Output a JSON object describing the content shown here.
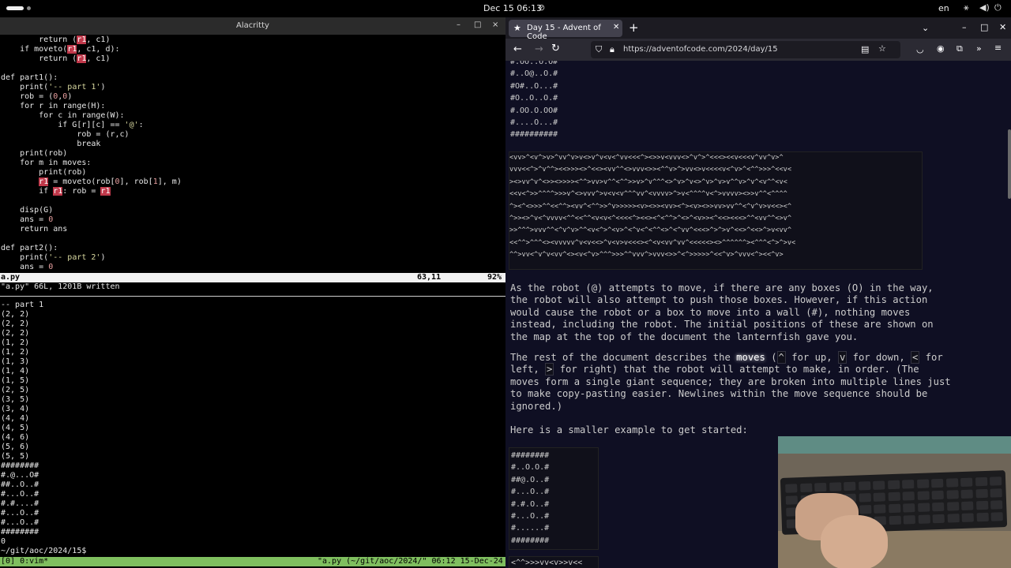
{
  "topbar": {
    "clock": "Dec 15  06:13",
    "language": "en"
  },
  "terminal": {
    "title": "Alacritty",
    "window_buttons": {
      "minimize": "–",
      "maximize": "□",
      "close": "×"
    },
    "statusline": {
      "file": "a.py",
      "position": "63,11",
      "percent": "92%"
    },
    "message": "\"a.py\" 66L, 1201B written",
    "output_lines": [
      "-- part 1",
      "(2, 2)",
      "(2, 2)",
      "(2, 2)",
      "(1, 2)",
      "(1, 2)",
      "(1, 3)",
      "(1, 4)",
      "(1, 5)",
      "(2, 5)",
      "(3, 5)",
      "(3, 4)",
      "(4, 4)",
      "(4, 5)",
      "(4, 6)",
      "(5, 6)",
      "(5, 5)",
      "########",
      "#.@...O#",
      "##..O..#",
      "#...O..#",
      "#.#....#",
      "#...O..#",
      "#...O..#",
      "########",
      "0",
      "~/git/aoc/2024/15$ "
    ],
    "tmux": {
      "left": "[0] 0:vim*",
      "right": "\"a.py (~/git/aoc/2024/\" 06:12 15-Dec-24"
    }
  },
  "browser": {
    "tab_title": "Day 15 - Advent of Code",
    "tab_favicon": "★",
    "url": "https://adventofcode.com/2024/day/15",
    "map_top": [
      "#.OO..O.O#",
      "#..O@..O.#",
      "#O#..O...#",
      "#O..O..O.#",
      "#.OO.O.OO#",
      "#....O...#",
      "##########"
    ],
    "moves_lines": [
      "<vv>^<v^>v>^vv^v>v<>v^v<v<^vv<<<^><>>v<vvv<>^v^>^<<<><<v<<<v^vv^v>^",
      "vvv<<^>^v^^><<>>><>^<<><vv^^<>vvv<>><^^v>^>vv<>v<<<<v<^v>^<^^>>>^<<v<",
      "><>vv^v^<>><>>>><^^>vv>v^^<^^>>v>^v^^^<>^v>^v<>^v>^v>v^^v>^v^<v^^<v<",
      "<<v<^>>^^^^>>>v^<>vvv^>v<v<v^^^vv^<vvvv>^>v<^^^^v<^>vvvv><>>v^^<^^^^",
      "^><^<>>>^^<<^^><vv^<^^>>^v>>>>><v><>><vv><^><v><>>vv>vv^^<^v^v>v<<><^",
      "^>><>^v<^vvvv<^^<<^^<v<v<^<<<<^><<><^<^^>^<>^<v>><^<<><<<>^^<vv^^<>v^",
      ">>^^^>vvv^^<^v^v>^^<v<^>^<v>^<^v<^<^^<>^<^vv^<<<>^>^>v^<<>^<<>^>v<vv^",
      "<<^^>^^^<><vvvvv^v<v<<>^v<v>v<<<><^<v<vv^vv^<<<<<><>^^^^^^><^^^<^>^>v<",
      "^^>vv<^v^v<vv^<><v<^v>^^^>>>^^vvv^>vvv<>>^<^>>>>>^<<^v>^vvv<^><<^v>"
    ],
    "para1": "As the robot (@) attempts to move, if there are any boxes (O) in the way, the robot will also attempt to push those boxes. However, if this action would cause the robot or a box to move into a wall (#), nothing moves instead, including the robot. The initial positions of these are shown on the map at the top of the document the lanternfish gave you.",
    "para2_parts": {
      "a": "The rest of the document describes the ",
      "b": "moves",
      "c": " (",
      "d": "^",
      "e": " for up, ",
      "f": "v",
      "g": " for down, ",
      "h": "<",
      "i": " for left, ",
      "j": ">",
      "k": " for right) that the robot will attempt to make, in order. (The moves form a single giant sequence; they are broken into multiple lines just to make copy-pasting easier. Newlines within the move sequence should be ignored.)"
    },
    "para3": "Here is a smaller example to get started:",
    "map_small": [
      "########",
      "#..O.O.#",
      "##@.O..#",
      "#...O..#",
      "#.#.O..#",
      "#...O..#",
      "#......#",
      "########"
    ],
    "moves_small": "<^^>>>vv<v>>v<<"
  }
}
